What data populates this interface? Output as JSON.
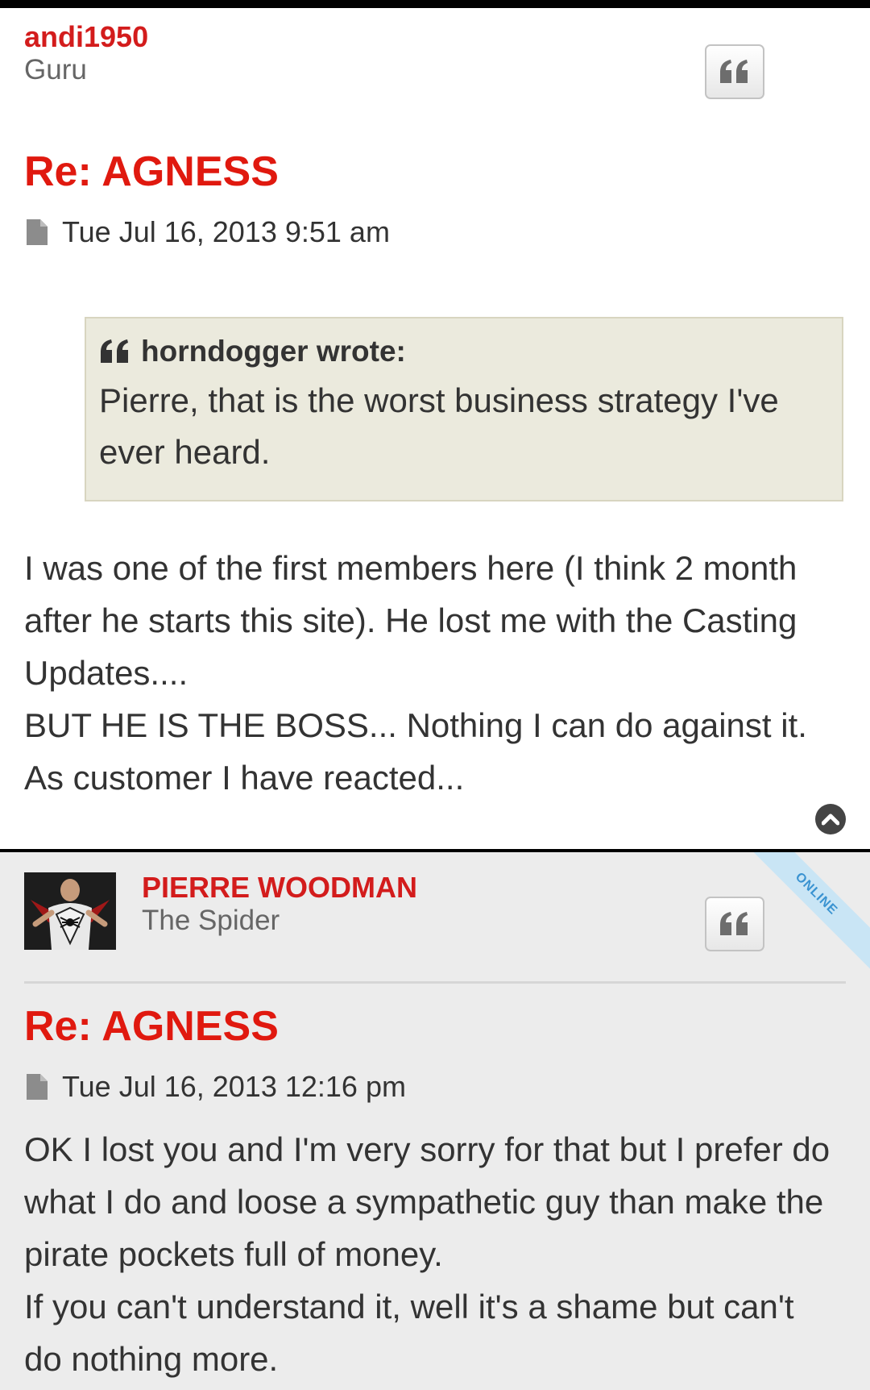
{
  "posts": [
    {
      "username": "andi1950",
      "rank": "Guru",
      "title": "Re: AGNESS",
      "date": "Tue Jul 16, 2013 9:51 am",
      "quote": {
        "author": "horndogger wrote:",
        "text": "Pierre, that is the worst business strategy I've ever heard."
      },
      "content": [
        "I was one of the first members here (I think 2 month after he starts this site). He lost me with the Casting Updates....",
        "BUT HE IS THE BOSS... Nothing I can do against it. As customer I have reacted..."
      ]
    },
    {
      "username": "PIERRE WOODMAN",
      "rank": "The Spider",
      "online_label": "ONLINE",
      "title": "Re: AGNESS",
      "date": "Tue Jul 16, 2013 12:16 pm",
      "content": [
        "OK I lost you and I'm very sorry for that but I prefer do what I do and loose a sympathetic guy than make the pirate pockets full of money.",
        "If you can't understand it, well it's a shame but can't do nothing more."
      ]
    }
  ],
  "colors": {
    "username": "#d31c1c",
    "title": "#e0190f",
    "quote_bg": "#ebeadd",
    "post2_bg": "#ececec",
    "online": "#3a93d1"
  },
  "icons": [
    "quote-icon",
    "file-icon",
    "back-to-top-icon",
    "spider-icon"
  ]
}
